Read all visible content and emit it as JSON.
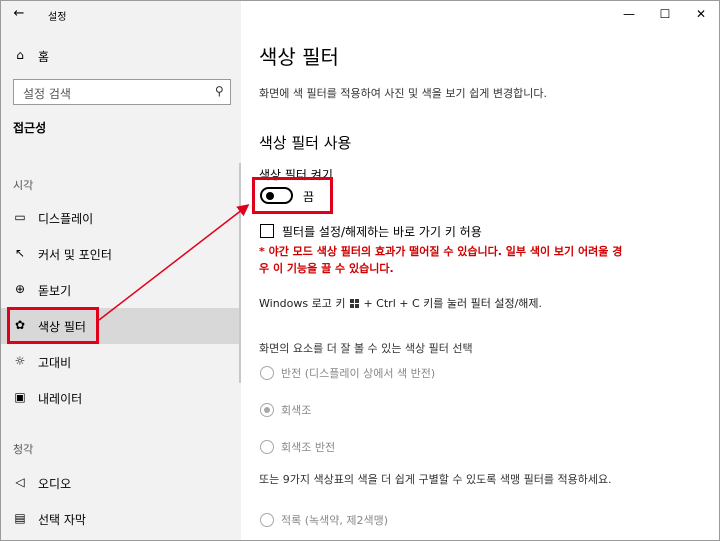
{
  "window": {
    "app_title": "설정",
    "back_icon": "back-arrow-icon",
    "controls": [
      "minimize-icon",
      "maximize-icon",
      "close-icon"
    ]
  },
  "sidebar": {
    "home_label": "홈",
    "search_placeholder": "설정 검색",
    "section_title": "접근성",
    "group_vision": "시각",
    "group_hearing": "청각",
    "items": [
      {
        "icon": "display-icon",
        "label": "디스플레이"
      },
      {
        "icon": "cursor-icon",
        "label": "커서 및 포인터"
      },
      {
        "icon": "magnifier-icon",
        "label": "돋보기"
      },
      {
        "icon": "color-palette-icon",
        "label": "색상 필터",
        "selected": true
      },
      {
        "icon": "sun-icon",
        "label": "고대비"
      },
      {
        "icon": "narrator-icon",
        "label": "내레이터"
      },
      {
        "icon": "speaker-icon",
        "label": "오디오"
      },
      {
        "icon": "captions-icon",
        "label": "선택 자막"
      }
    ]
  },
  "main": {
    "title": "색상 필터",
    "description": "화면에 색 필터를 적용하여 사진 및 색을 보기 쉽게 변경합니다.",
    "subtitle": "색상 필터 사용",
    "toggle_label": "색상 필터 켜기",
    "toggle_state": "끔",
    "toggle_on": false,
    "checkbox_label": "필터를 설정/해제하는 바로 가기 키 허용",
    "checkbox_checked": false,
    "warning": "* 야간 모드  색상 필터의 효과가 떨어질 수 있습니다. 일부 색이 보기 어려울 경우 이 기능을 끌 수 있습니다.",
    "shortcut_prefix": "Windows 로고 키",
    "shortcut_suffix": "+ Ctrl + C 키를 눌러 필터 설정/해제.",
    "filter_select_label": "화면의 요소를 더 잘 볼 수 있는 색상 필터 선택",
    "filters": [
      {
        "label": "반전 (디스플레이 상에서 색 반전)",
        "checked": false
      },
      {
        "label": "회색조",
        "checked": true
      },
      {
        "label": "회색조 반전",
        "checked": false
      }
    ],
    "colorblind_description": "또는 9가지 색상표의 색을 더 쉽게 구별할 수 있도록 색맹 필터를 적용하세요.",
    "colorblind_first": {
      "label": "적록 (녹색약, 제2색맹)",
      "checked": false
    }
  },
  "annotation_color": "#e0001b"
}
